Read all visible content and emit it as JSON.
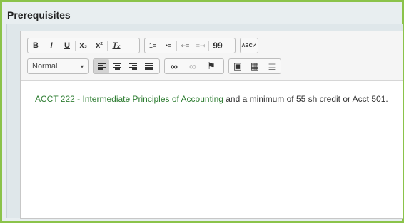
{
  "section": {
    "title": "Prerequisites"
  },
  "toolbar": {
    "bold": "B",
    "italic": "I",
    "underline": "U",
    "subscript": "x₂",
    "superscript": "x²",
    "remove_format": "Tₓ",
    "numbered_list": "1≡",
    "bulleted_list": "•≡",
    "decrease_indent": "⇤≡",
    "increase_indent": "≡⇥",
    "blockquote": "99",
    "spellcheck": "ABC✓",
    "format_select": "Normal",
    "align_left": "",
    "align_center": "",
    "align_right": "",
    "align_justify": "",
    "link": "∞",
    "unlink": "∞",
    "anchor": "⚑",
    "image": "▣",
    "table": "▦",
    "horizontal_rule": "≣"
  },
  "content": {
    "link_text": "ACCT 222 - Intermediate Principles of Accounting",
    "body_text": " and a minimum of 55 sh credit or Acct 501."
  },
  "colors": {
    "accent": "#8bc34a",
    "link": "#2e7d32"
  }
}
